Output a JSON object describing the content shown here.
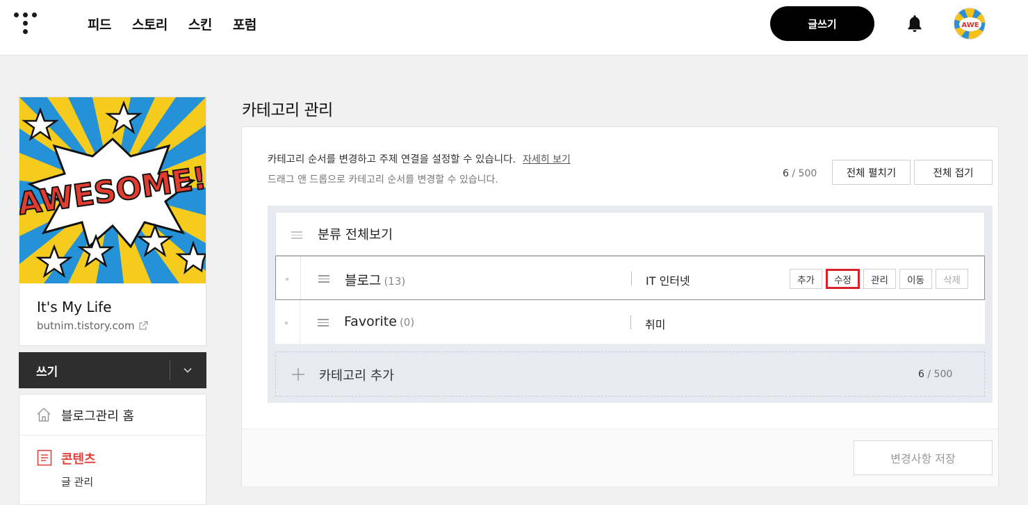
{
  "topnav": {
    "items": [
      "피드",
      "스토리",
      "스킨",
      "포럼"
    ]
  },
  "header": {
    "write_label": "글쓰기",
    "bell_icon": "bell-icon",
    "avatar_icon": "profile-avatar"
  },
  "sidebar": {
    "blog_title": "It's My Life",
    "blog_url": "butnim.tistory.com",
    "profile_image_text": "AWESOME!",
    "write_label": "쓰기",
    "menu": {
      "home_label": "블로그관리 홈",
      "content_label": "콘텐츠",
      "sub_post_manage": "글 관리"
    }
  },
  "main": {
    "title": "카테고리 관리",
    "desc1": "카테고리 순서를 변경하고 주제 연결을 설정할 수 있습니다.",
    "desc_link": "자세히 보기",
    "desc2": "드래그 앤 드롭으로 카테고리 순서를 변경할 수 있습니다.",
    "count_current": "6",
    "count_sep_max": " / 500",
    "expand_all": "전체 펼치기",
    "collapse_all": "전체 접기",
    "all_categories": "분류 전체보기",
    "categories": [
      {
        "name": "블로그",
        "count": "(13)",
        "topic": "IT 인터넷"
      },
      {
        "name": "Favorite",
        "count": "(0)",
        "topic": "취미"
      }
    ],
    "actions": {
      "add": "추가",
      "edit": "수정",
      "manage": "관리",
      "move": "이동",
      "delete": "삭제"
    },
    "add_category": "카테고리 추가",
    "add_count_current": "6",
    "add_count_max": " / 500",
    "save_label": "변경사항 저장"
  },
  "colors": {
    "accent_red": "#e0423a",
    "highlight_border": "#d9222a",
    "tree_bg": "#e7ebf1"
  }
}
